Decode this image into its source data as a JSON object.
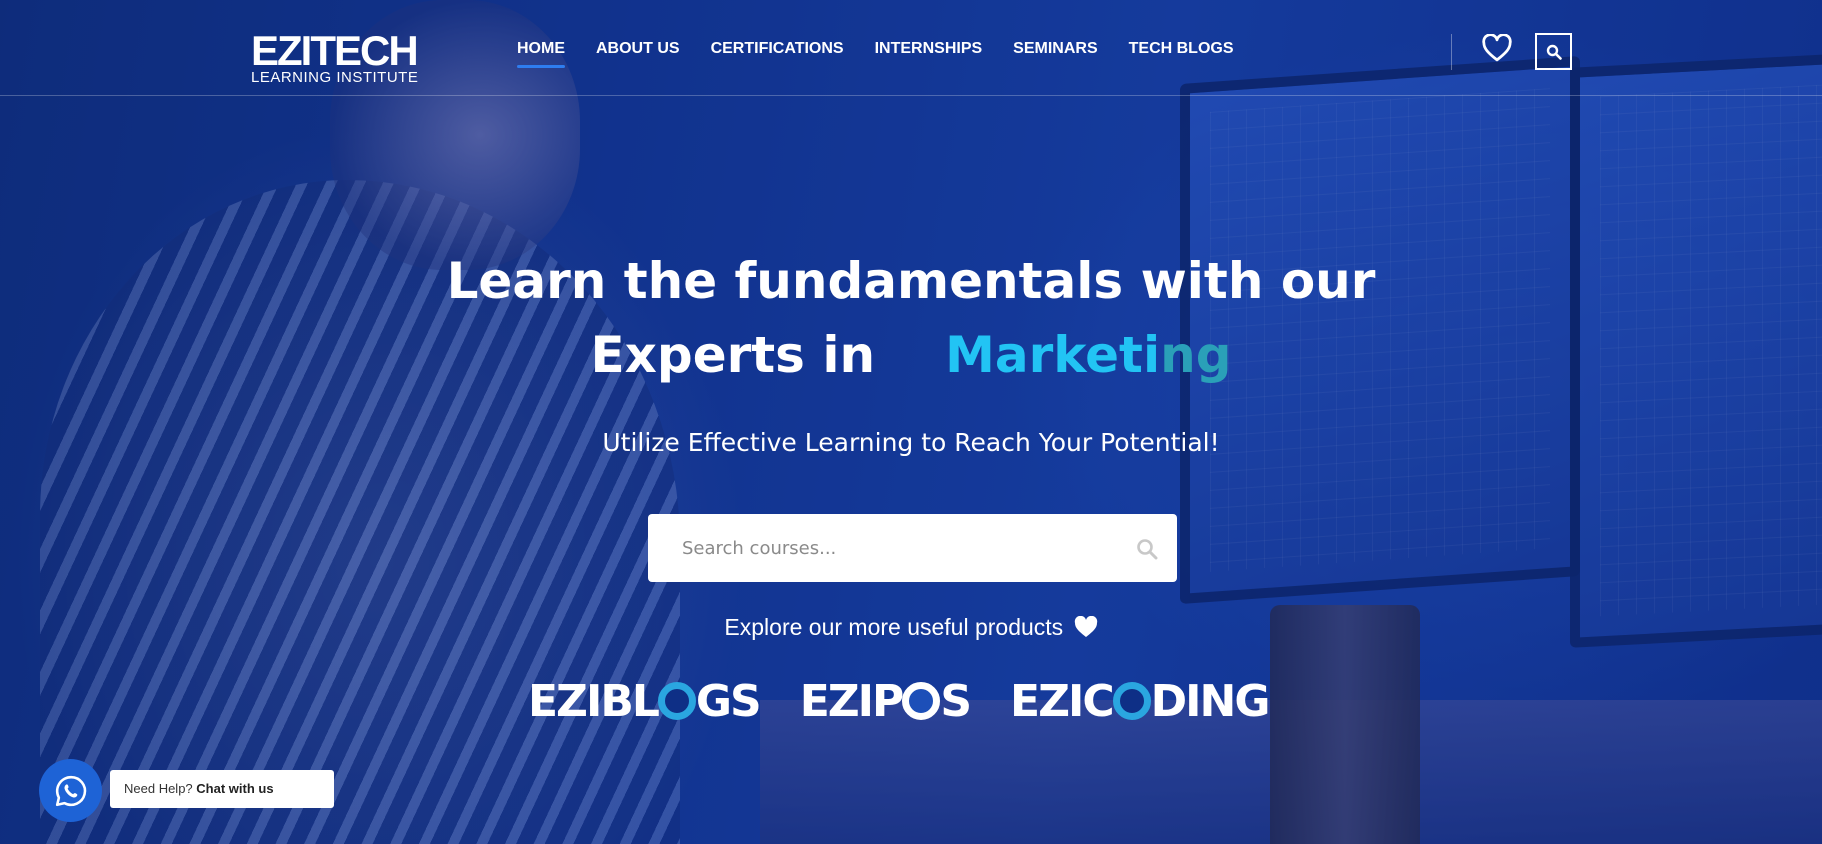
{
  "logo": {
    "main": "EZITECH",
    "sub": "LEARNING INSTITUTE"
  },
  "nav": {
    "items": [
      {
        "label": "HOME"
      },
      {
        "label": "ABOUT US"
      },
      {
        "label": "CERTIFICATIONS"
      },
      {
        "label": "INTERNSHIPS"
      },
      {
        "label": "SEMINARS"
      },
      {
        "label": "TECH BLOGS"
      }
    ],
    "active_index": 0
  },
  "header_icons": {
    "wishlist": "heart-icon",
    "search": "search-icon"
  },
  "hero": {
    "title_line1": "Learn the fundamentals with our",
    "title_line2_prefix": "Experts in",
    "title_line2_accent": "Marketi",
    "title_line2_accent_fade": "ng",
    "subtitle": "Utilize Effective Learning to Reach Your Potential!"
  },
  "search": {
    "placeholder": "Search courses..."
  },
  "explore": {
    "text": "Explore our more useful products"
  },
  "products": [
    {
      "name": "EZIBLOGS",
      "pre": "EZIBL",
      "post": "GS"
    },
    {
      "name": "EZIPOS",
      "pre": "EZIP",
      "post": "S"
    },
    {
      "name": "EZICODING",
      "pre": "EZIC",
      "post": "DING"
    }
  ],
  "chat": {
    "prefix": "Need Help?",
    "action": "Chat with us"
  },
  "colors": {
    "accent": "#22c4f4",
    "nav_underline": "#2e7df0",
    "whatsapp_button": "#1e63d6"
  }
}
